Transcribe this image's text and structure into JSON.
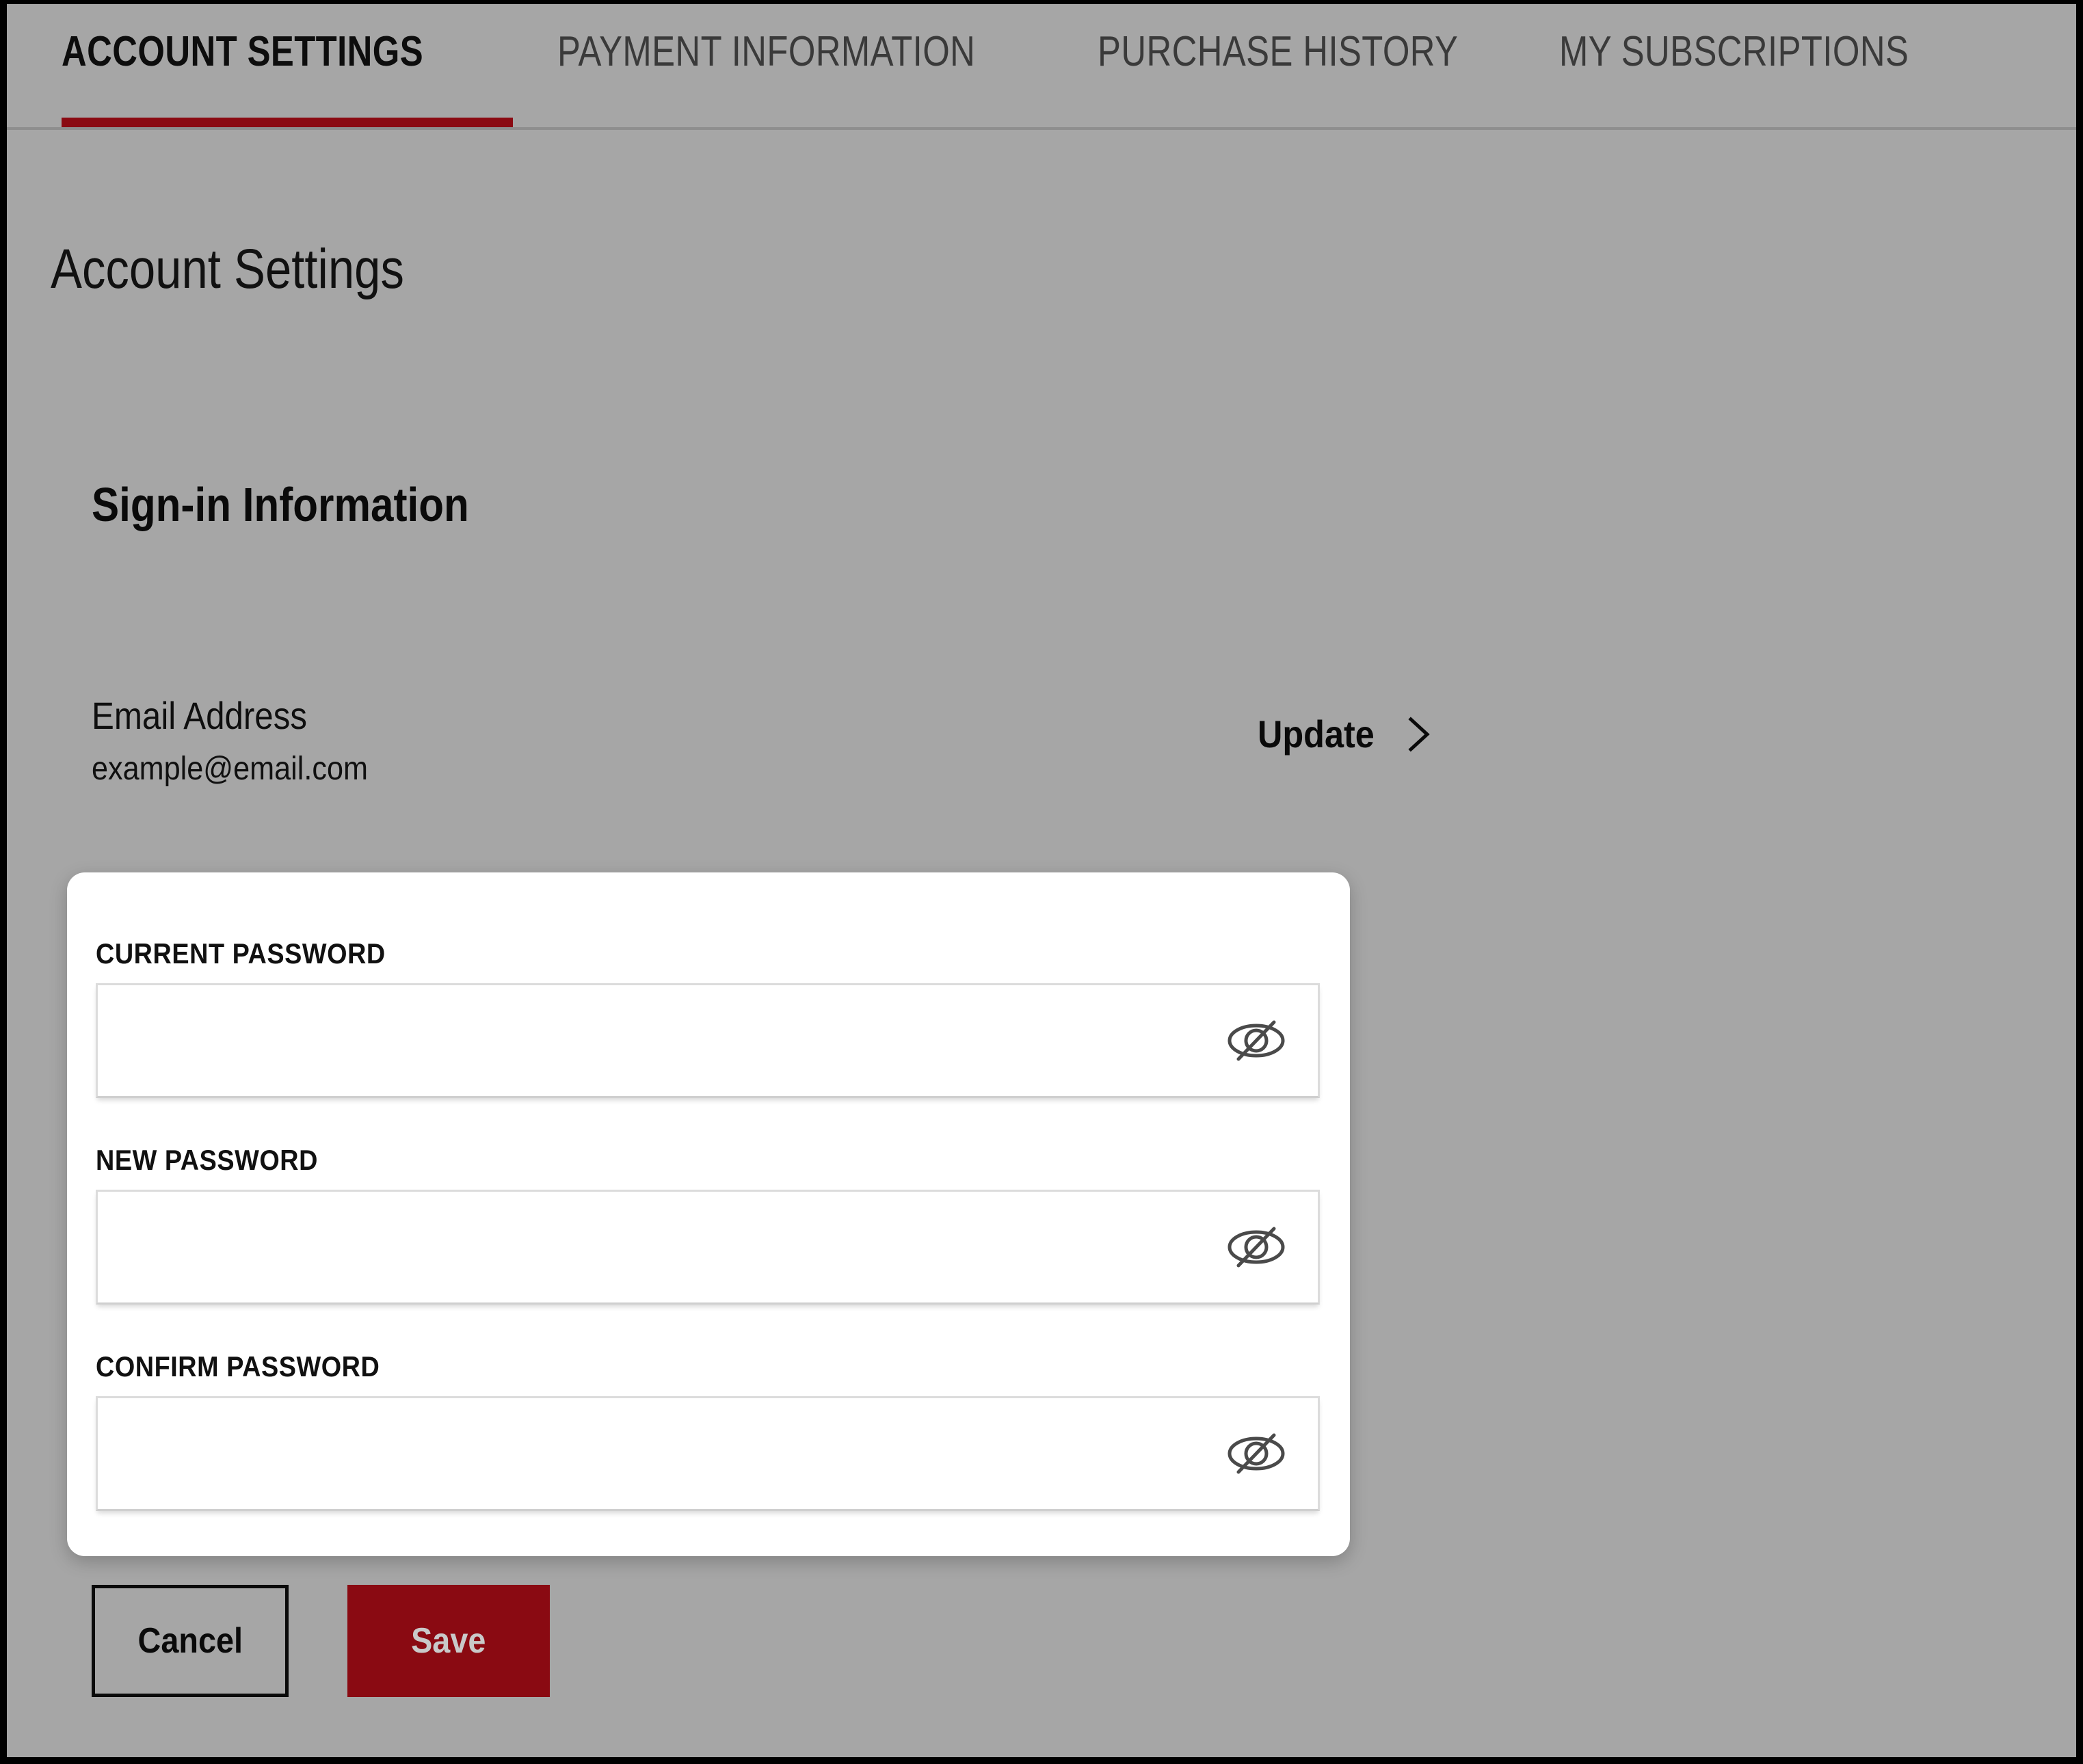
{
  "colors": {
    "background": "#a6a6a6",
    "accent_red": "#8a0a12",
    "card_background": "#ffffff",
    "tab_active_text": "#0d0d0d",
    "tab_inactive_text": "#3a3a3a",
    "save_button_text": "#c9c9c9"
  },
  "tabs": [
    {
      "label": "ACCOUNT SETTINGS",
      "active": true
    },
    {
      "label": "PAYMENT INFORMATION",
      "active": false
    },
    {
      "label": "PURCHASE HISTORY",
      "active": false
    },
    {
      "label": "MY SUBSCRIPTIONS",
      "active": false
    }
  ],
  "page": {
    "title": "Account Settings"
  },
  "section": {
    "title": "Sign-in Information"
  },
  "email": {
    "label": "Email Address",
    "value": "example@email.com",
    "update_label": "Update",
    "chevron_icon": "chevron-right-icon"
  },
  "password_card": {
    "fields": [
      {
        "label": "CURRENT PASSWORD",
        "value": "",
        "placeholder": "",
        "toggle_icon": "eye-slash-icon"
      },
      {
        "label": "NEW PASSWORD",
        "value": "",
        "placeholder": "",
        "toggle_icon": "eye-slash-icon"
      },
      {
        "label": "CONFIRM PASSWORD",
        "value": "",
        "placeholder": "",
        "toggle_icon": "eye-slash-icon"
      }
    ]
  },
  "actions": {
    "cancel_label": "Cancel",
    "save_label": "Save"
  }
}
